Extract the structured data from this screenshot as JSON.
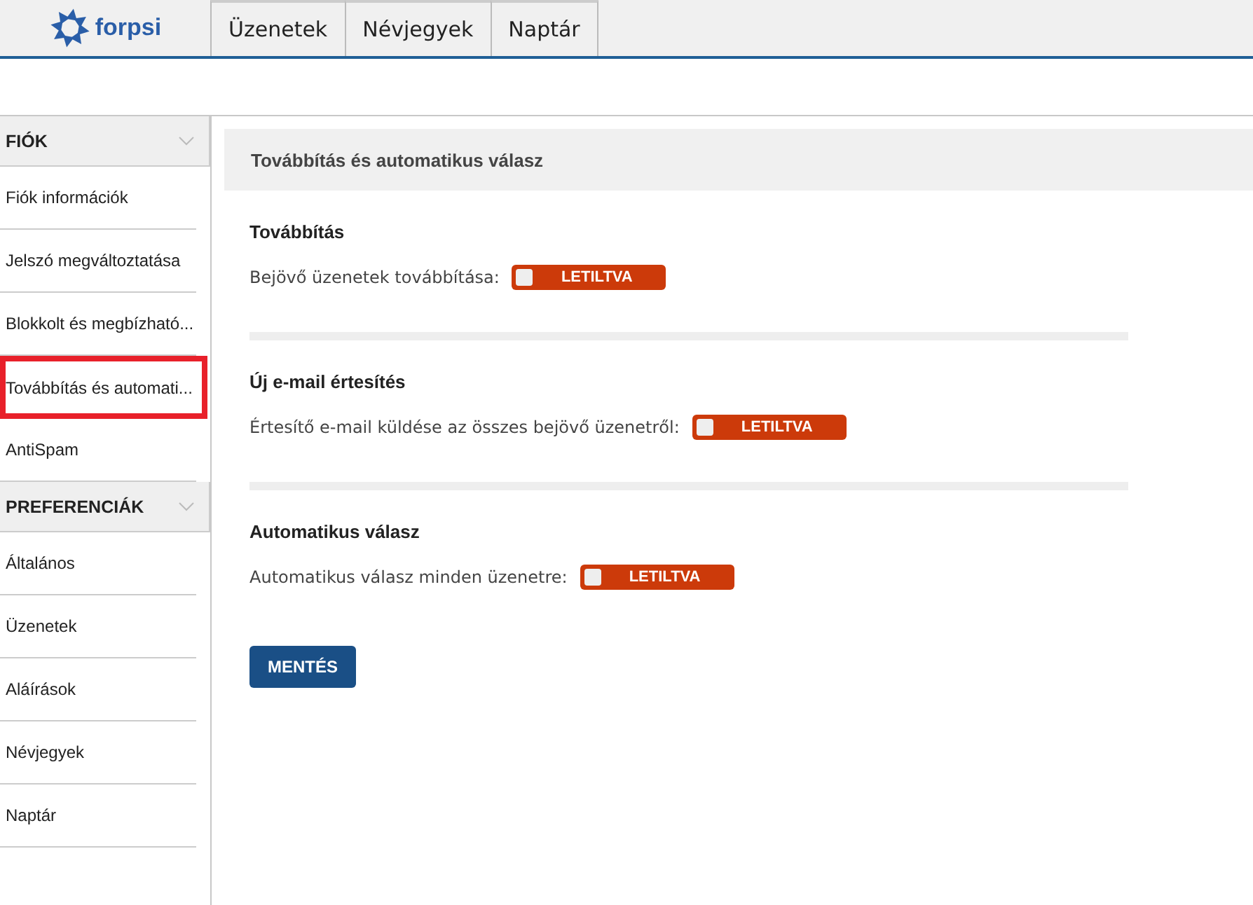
{
  "header": {
    "logo_text": "forpsi",
    "tabs": [
      {
        "label": "Üzenetek",
        "selected": false
      },
      {
        "label": "Névjegyek",
        "selected": false
      },
      {
        "label": "Naptár",
        "selected": false
      }
    ]
  },
  "sidebar": {
    "sections": [
      {
        "title": "FIÓK",
        "expanded": true,
        "items": [
          {
            "label": "Fiók információk",
            "selected": false
          },
          {
            "label": "Jelszó megváltoztatása",
            "selected": false
          },
          {
            "label": "Blokkolt és megbízható...",
            "selected": false
          },
          {
            "label": "Továbbítás és automati...",
            "selected": true
          },
          {
            "label": "AntiSpam",
            "selected": false
          }
        ]
      },
      {
        "title": "PREFERENCIÁK",
        "expanded": true,
        "items": [
          {
            "label": "Általános",
            "selected": false
          },
          {
            "label": "Üzenetek",
            "selected": false
          },
          {
            "label": "Aláírások",
            "selected": false
          },
          {
            "label": "Névjegyek",
            "selected": false
          },
          {
            "label": "Naptár",
            "selected": false
          }
        ]
      }
    ]
  },
  "panel": {
    "title": "Továbbítás és automatikus válasz",
    "sections": [
      {
        "heading": "Továbbítás",
        "label": "Bejövő üzenetek továbbítása:",
        "toggle": {
          "on": false,
          "text": "LETILTVA"
        }
      },
      {
        "heading": "Új e-mail értesítés",
        "label": "Értesítő e-mail küldése az összes bejövő üzenetről:",
        "toggle": {
          "on": false,
          "text": "LETILTVA"
        }
      },
      {
        "heading": "Automatikus válasz",
        "label": "Automatikus válasz minden üzenetre:",
        "toggle": {
          "on": false,
          "text": "LETILTVA"
        }
      }
    ],
    "save_button": "MENTÉS"
  }
}
